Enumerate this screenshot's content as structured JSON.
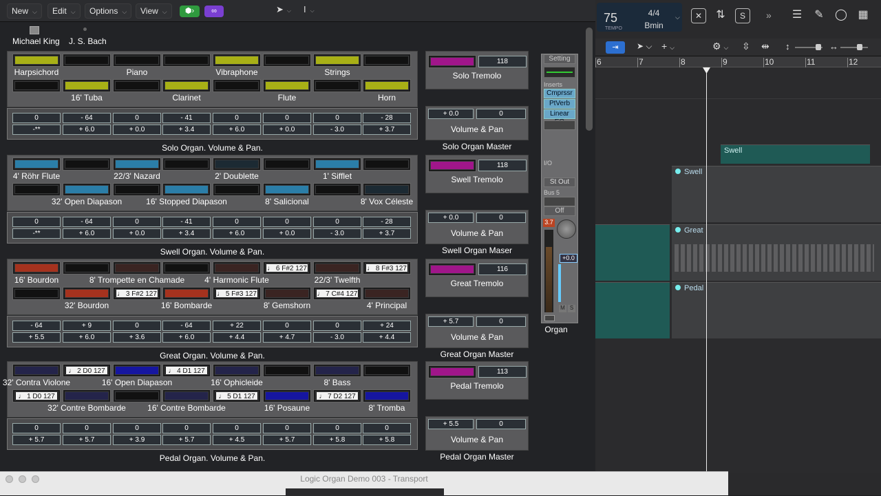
{
  "menubar": {
    "new": "New",
    "edit": "Edit",
    "options": "Options",
    "view": "View"
  },
  "header": {
    "author": "Michael King",
    "composer": "J. S. Bach"
  },
  "solo": {
    "row1": [
      {
        "label": "Harpsichord",
        "color": "#a8b016"
      },
      {
        "label": "",
        "color": "#111"
      },
      {
        "label": "Piano",
        "color": "#111"
      },
      {
        "label": "",
        "color": "#111"
      },
      {
        "label": "Vibraphone",
        "color": "#a8b016"
      },
      {
        "label": "",
        "color": "#111"
      },
      {
        "label": "Strings",
        "color": "#a8b016"
      },
      {
        "label": "",
        "color": "#111"
      }
    ],
    "row2": [
      {
        "label": "",
        "color": "#111"
      },
      {
        "label": "16' Tuba",
        "color": "#a8b016"
      },
      {
        "label": "",
        "color": "#111"
      },
      {
        "label": "Clarinet",
        "color": "#a8b016"
      },
      {
        "label": "",
        "color": "#111"
      },
      {
        "label": "Flute",
        "color": "#a8b016"
      },
      {
        "label": "",
        "color": "#111"
      },
      {
        "label": "Horn",
        "color": "#a8b016"
      }
    ],
    "vol": [
      "0",
      "- 64",
      "0",
      "- 41",
      "0",
      "0",
      "0",
      "- 28"
    ],
    "pan": [
      "-**",
      "+ 6.0",
      "+ 0.0",
      "+ 3.4",
      "+ 6.0",
      "+ 0.0",
      "- 3.0",
      "+ 3.7"
    ],
    "title": "Solo Organ. Volume & Pan.",
    "tremolo_value": "118",
    "tremolo_label": "Solo Tremolo",
    "master_vol": "+ 0.0",
    "master_pan": "0",
    "vp_label": "Volume & Pan",
    "master_label": "Solo Organ Master"
  },
  "swell": {
    "row1": [
      {
        "label": "4' Röhr Flute",
        "color": "#2b7ea8"
      },
      {
        "label": "",
        "color": "#111"
      },
      {
        "label": "22/3' Nazard",
        "color": "#2b7ea8"
      },
      {
        "label": "",
        "color": "#111"
      },
      {
        "label": "2' Doublette",
        "color": "#1c2a33"
      },
      {
        "label": "",
        "color": "#111"
      },
      {
        "label": "1' Sifflet",
        "color": "#2b7ea8"
      },
      {
        "label": "",
        "color": "#111"
      }
    ],
    "row2": [
      {
        "label": "",
        "color": "#111"
      },
      {
        "label": "32' Open Diapason",
        "color": "#2b7ea8"
      },
      {
        "label": "",
        "color": "#111"
      },
      {
        "label": "16' Stopped Diapason",
        "color": "#2b7ea8"
      },
      {
        "label": "",
        "color": "#111"
      },
      {
        "label": "8' Salicional",
        "color": "#2b7ea8"
      },
      {
        "label": "",
        "color": "#111"
      },
      {
        "label": "8' Vox Céleste",
        "color": "#1c2a33"
      }
    ],
    "vol": [
      "0",
      "- 64",
      "0",
      "- 41",
      "0",
      "0",
      "0",
      "- 28"
    ],
    "pan": [
      "-**",
      "+ 6.0",
      "+ 0.0",
      "+ 3.4",
      "+ 6.0",
      "+ 0.0",
      "- 3.0",
      "+ 3.7"
    ],
    "title": "Swell Organ. Volume & Pan.",
    "tremolo_value": "118",
    "tremolo_label": "Swell Tremolo",
    "master_vol": "+ 0.0",
    "master_pan": "0",
    "vp_label": "Volume & Pan",
    "master_label": "Swell Organ Maser"
  },
  "great": {
    "row1": [
      {
        "label": "16' Bourdon",
        "color": "#a5321e"
      },
      {
        "label": "",
        "color": "#111"
      },
      {
        "label": "8' Trompette en Chamade",
        "color": "#3a2422"
      },
      {
        "label": "",
        "color": "#111"
      },
      {
        "label": "4' Harmonic Flute",
        "color": "#3a2422"
      },
      {
        "label": "",
        "color": "#111",
        "note": "♩ 6 F#2  127"
      },
      {
        "label": "22/3' Twelfth",
        "color": "#3a2422"
      },
      {
        "label": "",
        "color": "#111",
        "note": "♩ 8 F#3  127"
      }
    ],
    "row2": [
      {
        "label": "",
        "color": "#111"
      },
      {
        "label": "32' Bourdon",
        "color": "#a5321e"
      },
      {
        "label": "",
        "color": "#111",
        "note": "♩ 3 F#2  127"
      },
      {
        "label": "16' Bombarde",
        "color": "#a5321e"
      },
      {
        "label": "",
        "color": "#111",
        "note": "♩ 5 F#3  127"
      },
      {
        "label": "8' Gemshorn",
        "color": "#3a2422"
      },
      {
        "label": "",
        "color": "#111",
        "note": "♩ 7 C#4  127"
      },
      {
        "label": "4' Principal",
        "color": "#3a2422"
      }
    ],
    "vol": [
      "- 64",
      "+ 9",
      "0",
      "- 64",
      "+ 22",
      "0",
      "0",
      "+ 24"
    ],
    "pan": [
      "+ 5.5",
      "+ 6.0",
      "+ 3.6",
      "+ 6.0",
      "+ 4.4",
      "+ 4.7",
      "- 3.0",
      "+ 4.4"
    ],
    "title": "Great Organ. Volume & Pan.",
    "tremolo_value": "116",
    "tremolo_label": "Great Tremolo",
    "master_vol": "+ 5.7",
    "master_pan": "0",
    "vp_label": "Volume & Pan",
    "master_label": "Great Organ Master"
  },
  "pedal": {
    "row1": [
      {
        "label": "32' Contra Violone",
        "color": "#24244a"
      },
      {
        "label": "",
        "color": "#111",
        "note": "♩ 2 D0   127"
      },
      {
        "label": "16' Open Diapason",
        "color": "#1616a0"
      },
      {
        "label": "",
        "color": "#111",
        "note": "♩ 4 D1   127"
      },
      {
        "label": "16' Ophicleide",
        "color": "#24244a"
      },
      {
        "label": "",
        "color": "#111"
      },
      {
        "label": "8' Bass",
        "color": "#24244a"
      },
      {
        "label": "",
        "color": "#111"
      }
    ],
    "row2": [
      {
        "label": "",
        "color": "#111",
        "note": "♩ 1 D0   127"
      },
      {
        "label": "32' Contre Bombarde",
        "color": "#24244a"
      },
      {
        "label": "",
        "color": "#111"
      },
      {
        "label": "16' Contre Bombarde",
        "color": "#24244a"
      },
      {
        "label": "",
        "color": "#111",
        "note": "♩ 5 D1   127"
      },
      {
        "label": "16' Posaune",
        "color": "#1616a0"
      },
      {
        "label": "",
        "color": "#111",
        "note": "♩ 7 D2   127"
      },
      {
        "label": "8' Tromba",
        "color": "#1616a0"
      }
    ],
    "vol": [
      "0",
      "0",
      "0",
      "0",
      "0",
      "0",
      "0",
      "0"
    ],
    "pan": [
      "+ 5.7",
      "+ 5.7",
      "+ 3.9",
      "+ 5.7",
      "+ 4.5",
      "+ 5.7",
      "+ 5.8",
      "+ 5.8"
    ],
    "title": "Pedal Organ. Volume & Pan.",
    "tremolo_value": "113",
    "tremolo_label": "Pedal Tremolo",
    "master_vol": "+ 5.5",
    "master_pan": "0",
    "vp_label": "Volume & Pan",
    "master_label": "Pedal Organ Master"
  },
  "mixer": {
    "setting": "Setting",
    "inserts": "Inserts",
    "plugins": [
      "Cmprssr",
      "PtVerb",
      "Linear EQ"
    ],
    "io": "I/O",
    "stout": "St Out",
    "bus": "Bus 5",
    "off": "Off",
    "peak": "3.7",
    "fader": "+0.0",
    "m": "M",
    "s": "S",
    "channel": "Organ"
  },
  "lcd": {
    "tempo": "75",
    "tempo_label": "TEMPO",
    "sig": "4/4",
    "key": "Bmin"
  },
  "ruler": [
    "6",
    "7",
    "8",
    "9",
    "10",
    "11",
    "12"
  ],
  "tracks": {
    "swell_top": "Swell",
    "swell": "Swell",
    "great": "Great",
    "pedal": "Pedal"
  },
  "transport": {
    "title": "Logic Organ Demo 003 - Transport"
  }
}
